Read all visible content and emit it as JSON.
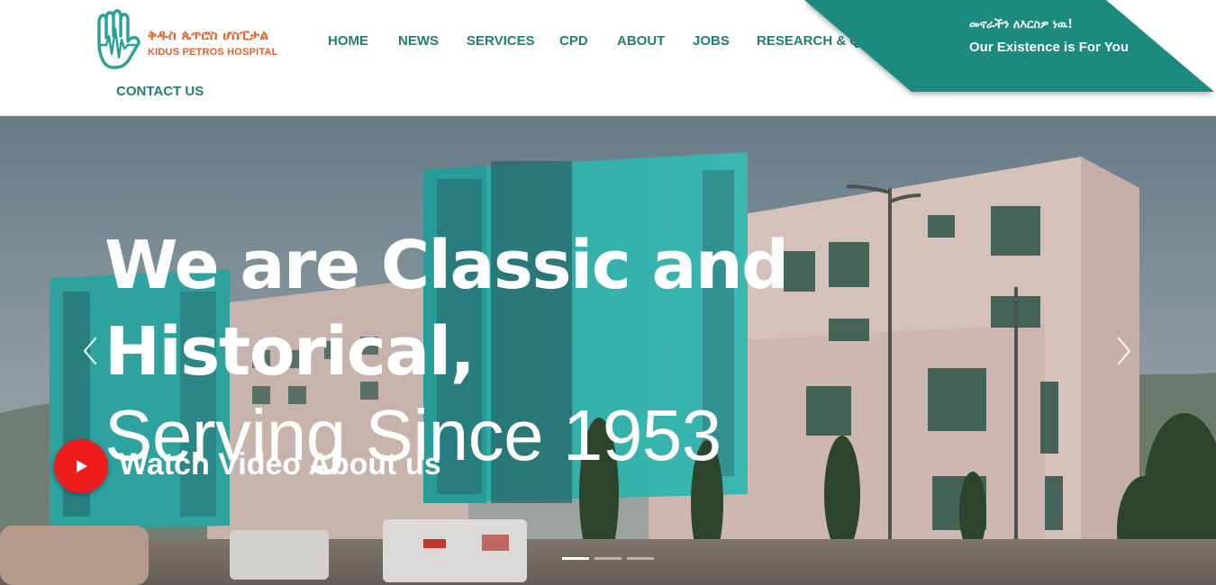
{
  "brand": {
    "name_amharic": "ቅዱስ ጴጥሮስ ሆስፒታል",
    "name_english": "KIDUS PETROS HOSPITAL",
    "logo_icon": "hand-heartbeat-icon",
    "brand_color": "#e0602a",
    "accent_color": "#1fa08f"
  },
  "nav": {
    "items": [
      {
        "label": "HOME"
      },
      {
        "label": "NEWS"
      },
      {
        "label": "SERVICES"
      },
      {
        "label": "CPD"
      },
      {
        "label": "ABOUT"
      },
      {
        "label": "JOBS"
      },
      {
        "label": "RESEARCH & QI"
      },
      {
        "label": "CONTACT US"
      }
    ],
    "color": "#1f7e76"
  },
  "tagline": {
    "amharic": "መኖራችን ለእርስዎ ነዉ!",
    "english": "Our Existence is For You",
    "band_color": "#1f8a7e"
  },
  "hero": {
    "headline_line1": "We are Classic and",
    "headline_line2": "Historical,",
    "subheadline": "Serving Since 1953",
    "video_cta": "Watch Video About us",
    "play_icon": "play-icon",
    "prev_icon": "chevron-left-icon",
    "next_icon": "chevron-right-icon",
    "slides_total": 3,
    "active_slide": 1
  }
}
